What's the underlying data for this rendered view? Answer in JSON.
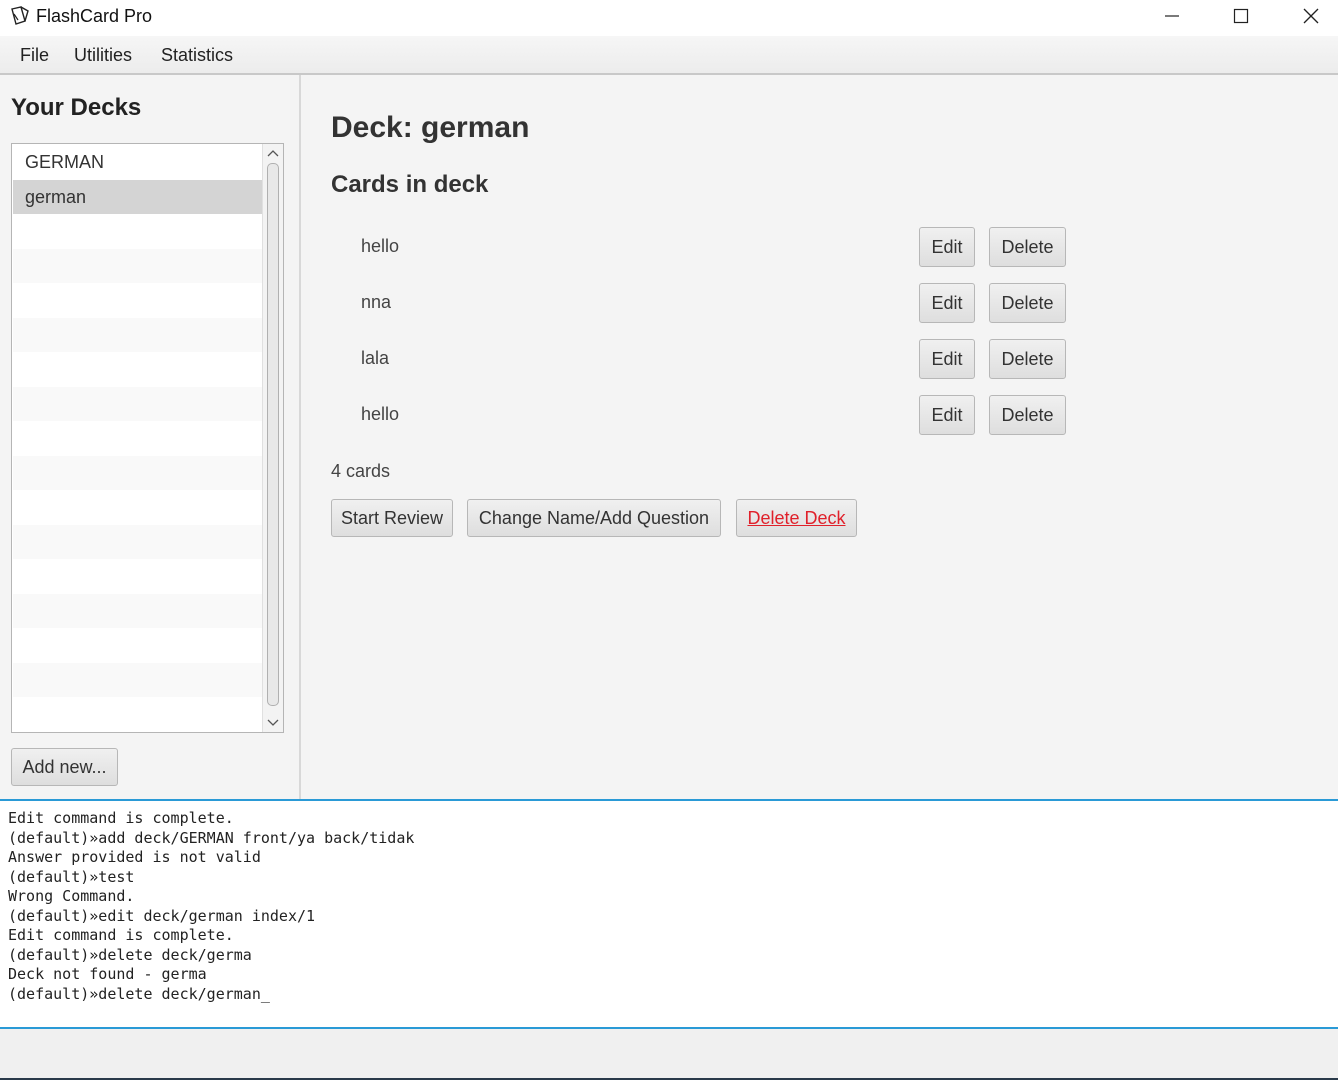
{
  "window": {
    "title": "FlashCard Pro",
    "icon": "cards-icon",
    "controls": [
      "minimize-icon",
      "maximize-icon",
      "close-icon"
    ]
  },
  "menu": {
    "items": [
      "File",
      "Utilities",
      "Statistics"
    ]
  },
  "sidebar": {
    "heading": "Your Decks",
    "decks": [
      "GERMAN",
      "german"
    ],
    "selected_deck": "german",
    "add_button": "Add new..."
  },
  "main": {
    "deck_title": "Deck: german",
    "cards_heading": "Cards in deck",
    "cards": [
      {
        "front": "hello",
        "edit": "Edit",
        "delete": "Delete"
      },
      {
        "front": "nna",
        "edit": "Edit",
        "delete": "Delete"
      },
      {
        "front": "lala",
        "edit": "Edit",
        "delete": "Delete"
      },
      {
        "front": "hello",
        "edit": "Edit",
        "delete": "Delete"
      }
    ],
    "card_count": "4 cards",
    "actions": {
      "start_review": "Start Review",
      "change_name": "Change Name/Add Question",
      "delete_deck": "Delete Deck"
    }
  },
  "console": {
    "lines": [
      "Edit command is complete.",
      "(default)»add deck/GERMAN front/ya back/tidak",
      "Answer provided is not valid",
      "(default)»test",
      "Wrong Command.",
      "(default)»edit deck/german index/1",
      "Edit command is complete.",
      "(default)»delete deck/germa",
      "Deck not found - germa",
      "(default)»delete deck/german_"
    ]
  },
  "colors": {
    "accent": "#2a9ad6",
    "danger": "#e0202a",
    "selected_row": "#d4d4d4"
  }
}
